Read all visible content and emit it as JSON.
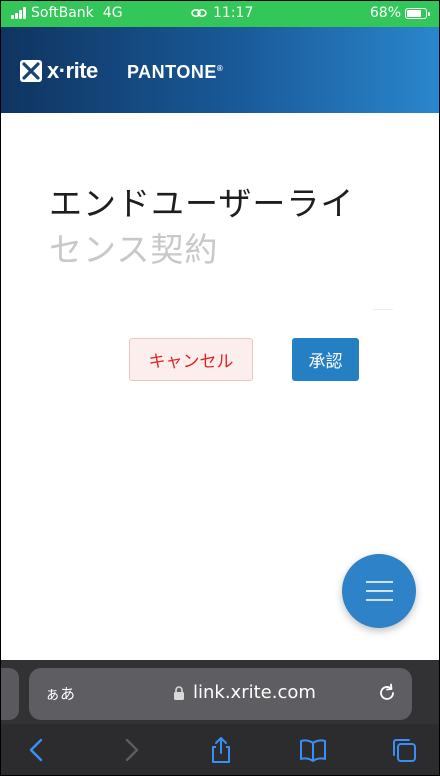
{
  "status_bar": {
    "carrier": "SoftBank",
    "network": "4G",
    "time": "11:17",
    "battery": "68%",
    "bg_color": "#33c759"
  },
  "header": {
    "brand": "x·rite",
    "partner": "PANTONE",
    "partner_mark": "®"
  },
  "main": {
    "title_line1": "エンドユーザーライ",
    "title_line2": "センス契約",
    "cancel_label": "キャンセル",
    "accept_label": "承認",
    "menu_icon": "hamburger-icon"
  },
  "browser": {
    "text_size_label": "ぁあ",
    "url": "link.xrite.com",
    "icons": [
      "back-icon",
      "forward-icon",
      "share-icon",
      "bookmarks-icon",
      "tabs-icon"
    ]
  },
  "colors": {
    "accent": "#2580c3",
    "cancel_text": "#e02424",
    "header_dark": "#0f3460",
    "header_light": "#2a86cc"
  }
}
